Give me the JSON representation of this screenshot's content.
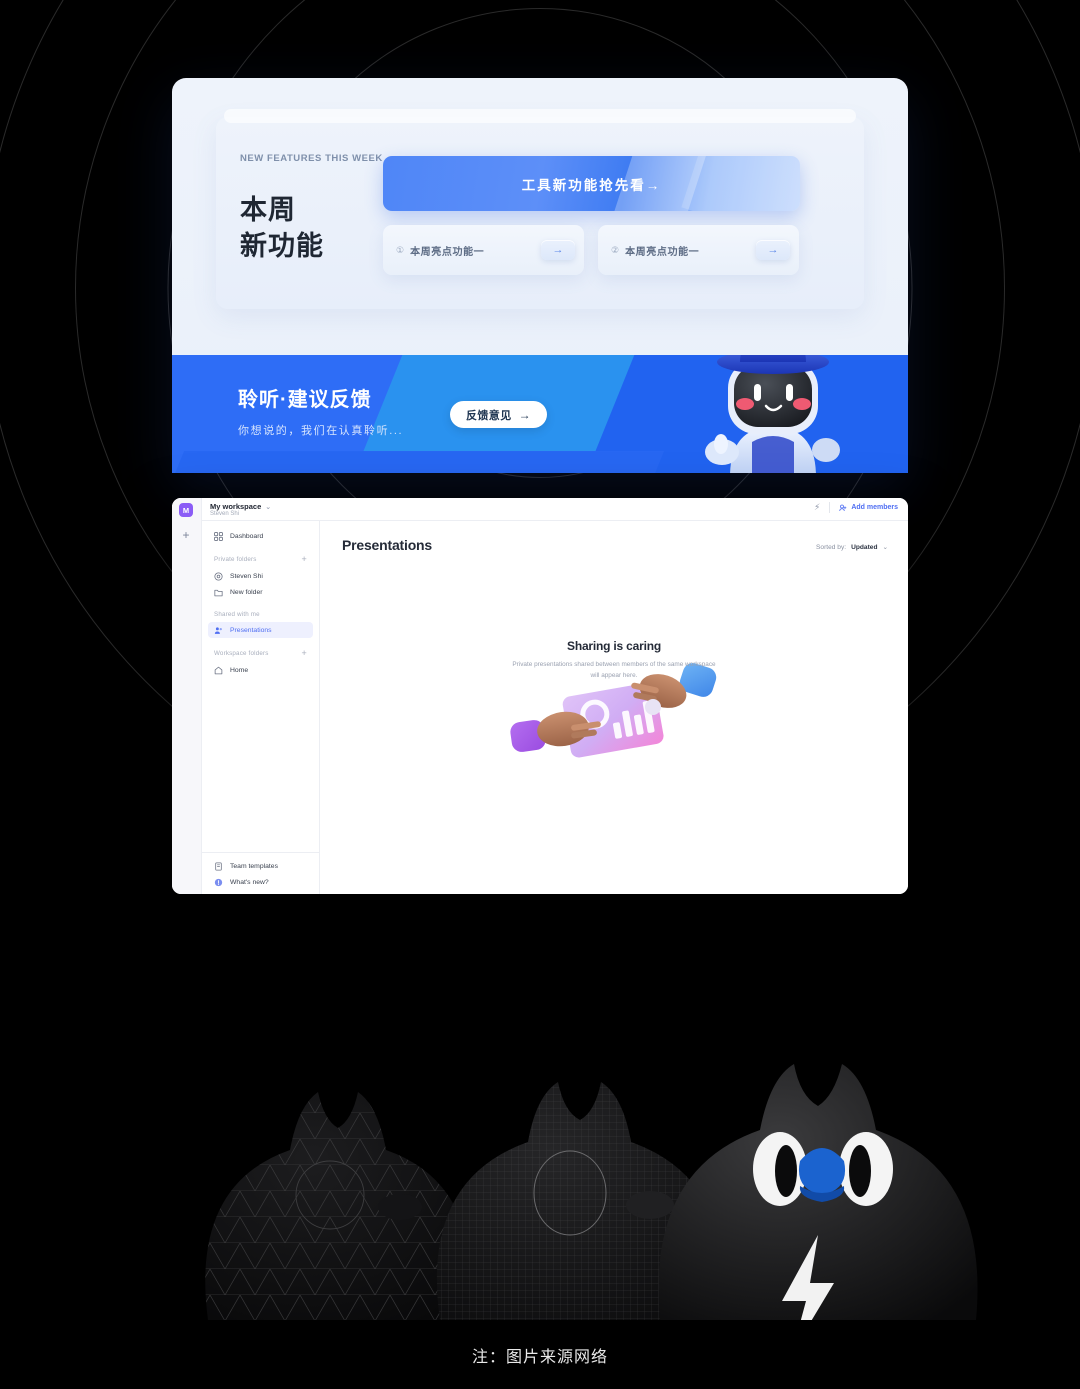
{
  "promo": {
    "eyebrow": "NEW FEATURES THIS WEEK",
    "title_line1": "本周",
    "title_line2": "新功能",
    "hero_banner_label": "工具新功能抢先看→",
    "features": [
      {
        "num": "①",
        "label": "本周亮点功能一",
        "arrow": "→"
      },
      {
        "num": "②",
        "label": "本周亮点功能一",
        "arrow": "→"
      }
    ]
  },
  "feedback_banner": {
    "title": "聆听·建议反馈",
    "subtitle": "你想说的，我们在认真聆听...",
    "button_label": "反馈意见",
    "button_arrow": "→",
    "bg_color": "#2f6bf5",
    "accent_color": "#2a92ef"
  },
  "app": {
    "topbar": {
      "avatar_letter": "M",
      "workspace_name": "My workspace",
      "workspace_caret": "⌄",
      "user_name": "Steven Shi",
      "add_button": "+",
      "bolt_icon": "⚡",
      "add_members_label": "Add members"
    },
    "sidebar": {
      "dashboard": {
        "label": "Dashboard",
        "icon": "grid-icon"
      },
      "groups": [
        {
          "label": "Private folders",
          "plus": "+",
          "items": [
            {
              "label": "Steven Shi",
              "icon": "at-icon"
            },
            {
              "label": "New folder",
              "icon": "folder-icon"
            }
          ]
        },
        {
          "label": "Shared with me",
          "plus": "",
          "items": [
            {
              "label": "Presentations",
              "icon": "people-icon",
              "active": true
            }
          ]
        },
        {
          "label": "Workspace folders",
          "plus": "+",
          "items": [
            {
              "label": "Home",
              "icon": "home-icon"
            }
          ]
        }
      ],
      "bottom_items": [
        {
          "label": "Team templates",
          "icon": "template-icon"
        },
        {
          "label": "What's new?",
          "icon": "whatsnew-icon"
        }
      ]
    },
    "content": {
      "title": "Presentations",
      "sorted_by_label": "Sorted by:",
      "sorted_by_value": "Updated",
      "sorted_by_caret": "⌄",
      "empty_title": "Sharing is caring",
      "empty_subtitle": "Private presentations shared between members of the same workspace will appear here."
    }
  },
  "caption": "注：图片来源网络",
  "colors": {
    "brand_blue": "#2f6bf5",
    "accent_indigo": "#4f6ef2",
    "avatar_purple": "#8b5cf6",
    "page_bg": "#000000",
    "beak_blue": "#1464d8"
  }
}
